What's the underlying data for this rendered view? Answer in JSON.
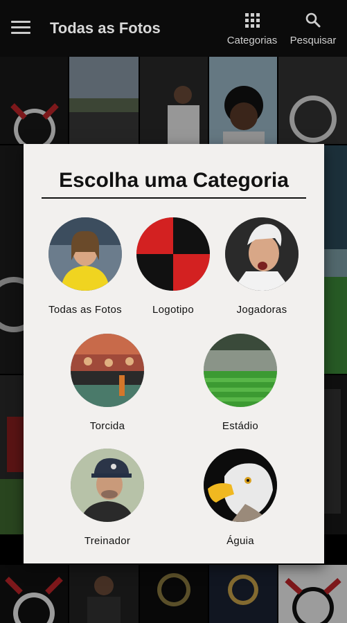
{
  "appbar": {
    "title": "Todas as Fotos",
    "menu_icon": "hamburger-menu-icon",
    "actions": [
      {
        "label": "Categorias",
        "icon": "grid-icon"
      },
      {
        "label": "Pesquisar",
        "icon": "search-icon"
      }
    ]
  },
  "dialog": {
    "title": "Escolha uma Categoria",
    "categories": [
      {
        "label": "Todas as Fotos"
      },
      {
        "label": "Logotipo"
      },
      {
        "label": "Jogadoras"
      },
      {
        "label": "Torcida"
      },
      {
        "label": "Estádio"
      },
      {
        "label": "Treinador"
      },
      {
        "label": "Águia"
      }
    ]
  },
  "colors": {
    "appbar_bg": "#0b0b0b",
    "dialog_bg": "#f2f0ee",
    "logo_red": "#d32121",
    "logo_black": "#111111"
  }
}
